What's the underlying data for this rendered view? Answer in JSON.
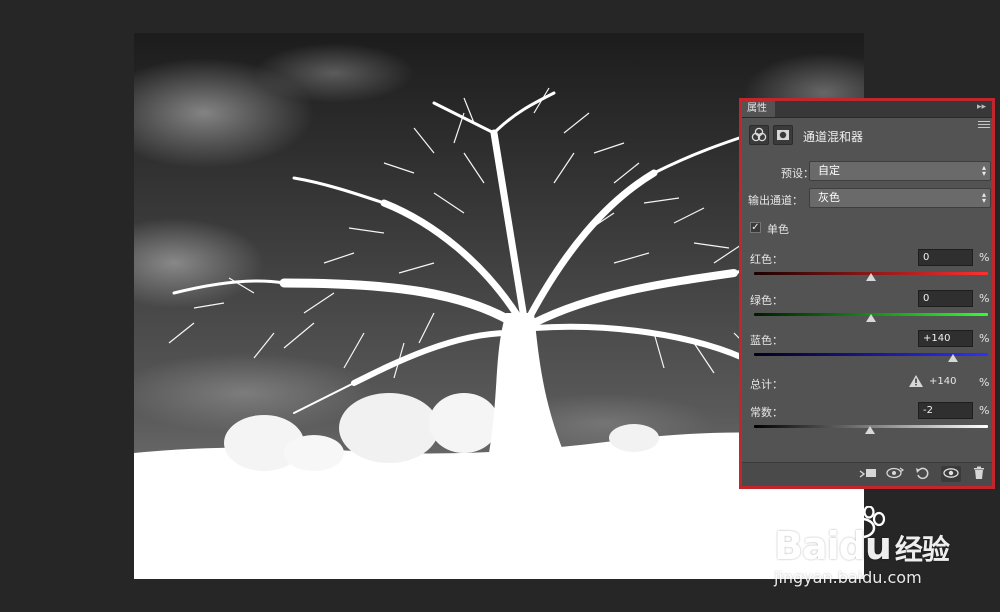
{
  "panel": {
    "tab_label": "属性",
    "collapse_glyph": "▸▸",
    "adjustment_icon": "channel-mixer-icon",
    "mask_icon": "layer-mask-icon",
    "title": "通道混和器",
    "preset_label": "预设：",
    "preset_value": "自定",
    "output_label": "输出通道：",
    "output_value": "灰色",
    "monochrome_label": "单色",
    "monochrome_checked": true,
    "check_glyph": "✓",
    "select_arrows": "▴▾",
    "red_label": "红色：",
    "red_value": "0",
    "red_level": 0,
    "green_label": "绿色：",
    "green_value": "0",
    "green_level": 0,
    "blue_label": "蓝色：",
    "blue_value": "+140",
    "blue_level": 140,
    "total_label": "总计：",
    "total_value": "+140",
    "constant_label": "常数：",
    "constant_value": "-2",
    "constant_level": -2,
    "percent": "%",
    "accent_border": "#c0262c"
  },
  "bottom_bar": {
    "clip_icon": "clip-to-layer-icon",
    "view_previous_icon": "view-previous-state-icon",
    "reset_icon": "reset-icon",
    "visibility_icon": "eye-icon",
    "delete_icon": "trash-icon"
  },
  "watermark": {
    "main": "Bai",
    "brand2": "du",
    "cn": "经验",
    "sub": "jingyan.baidu.com"
  }
}
